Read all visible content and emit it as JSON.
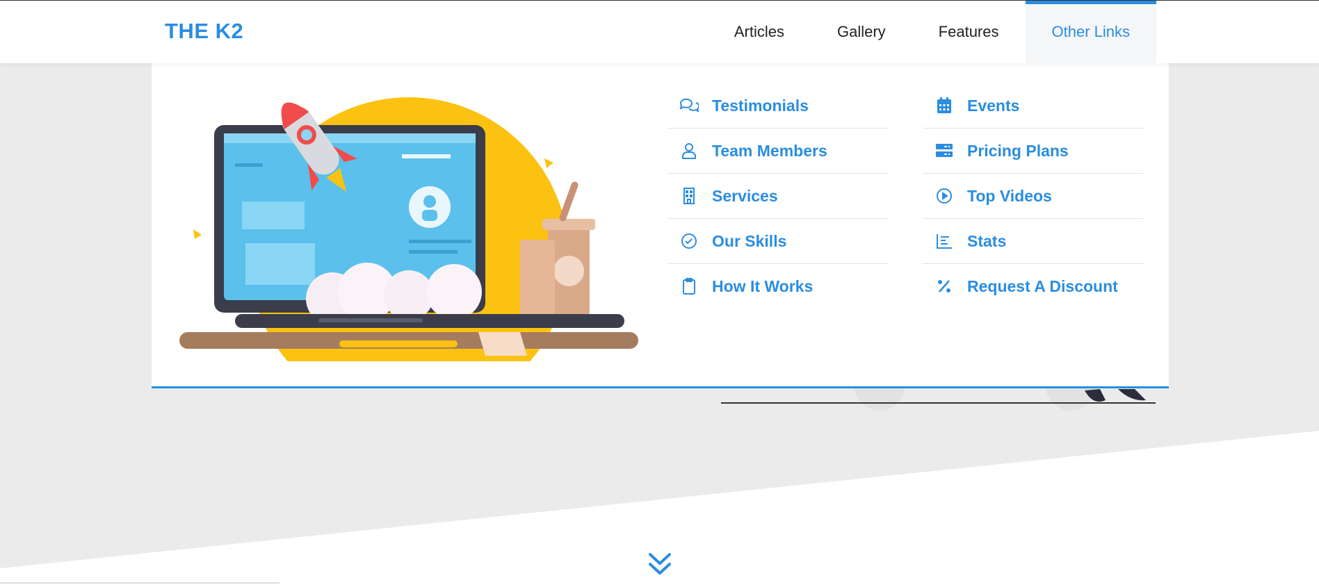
{
  "brand": {
    "logo": "THE K2",
    "accent": "#2a8de0"
  },
  "nav": {
    "items": [
      {
        "label": "Articles",
        "active": false
      },
      {
        "label": "Gallery",
        "active": false
      },
      {
        "label": "Features",
        "active": false
      },
      {
        "label": "Other Links",
        "active": true
      }
    ]
  },
  "mega_menu": {
    "column1": [
      {
        "label": "Testimonials",
        "icon": "chat-bubbles-icon"
      },
      {
        "label": "Team Members",
        "icon": "user-icon"
      },
      {
        "label": "Services",
        "icon": "building-icon"
      },
      {
        "label": "Our Skills",
        "icon": "check-circle-icon"
      },
      {
        "label": "How It Works",
        "icon": "clipboard-icon"
      }
    ],
    "column2": [
      {
        "label": "Events",
        "icon": "calendar-icon"
      },
      {
        "label": "Pricing Plans",
        "icon": "server-icon"
      },
      {
        "label": "Top Videos",
        "icon": "play-circle-icon"
      },
      {
        "label": "Stats",
        "icon": "chart-icon"
      },
      {
        "label": "Request A Discount",
        "icon": "percent-icon"
      }
    ]
  },
  "colors": {
    "background_gray": "#ebebeb",
    "illustration_sun": "#fcc211",
    "screen_blue": "#5bc0eb"
  }
}
